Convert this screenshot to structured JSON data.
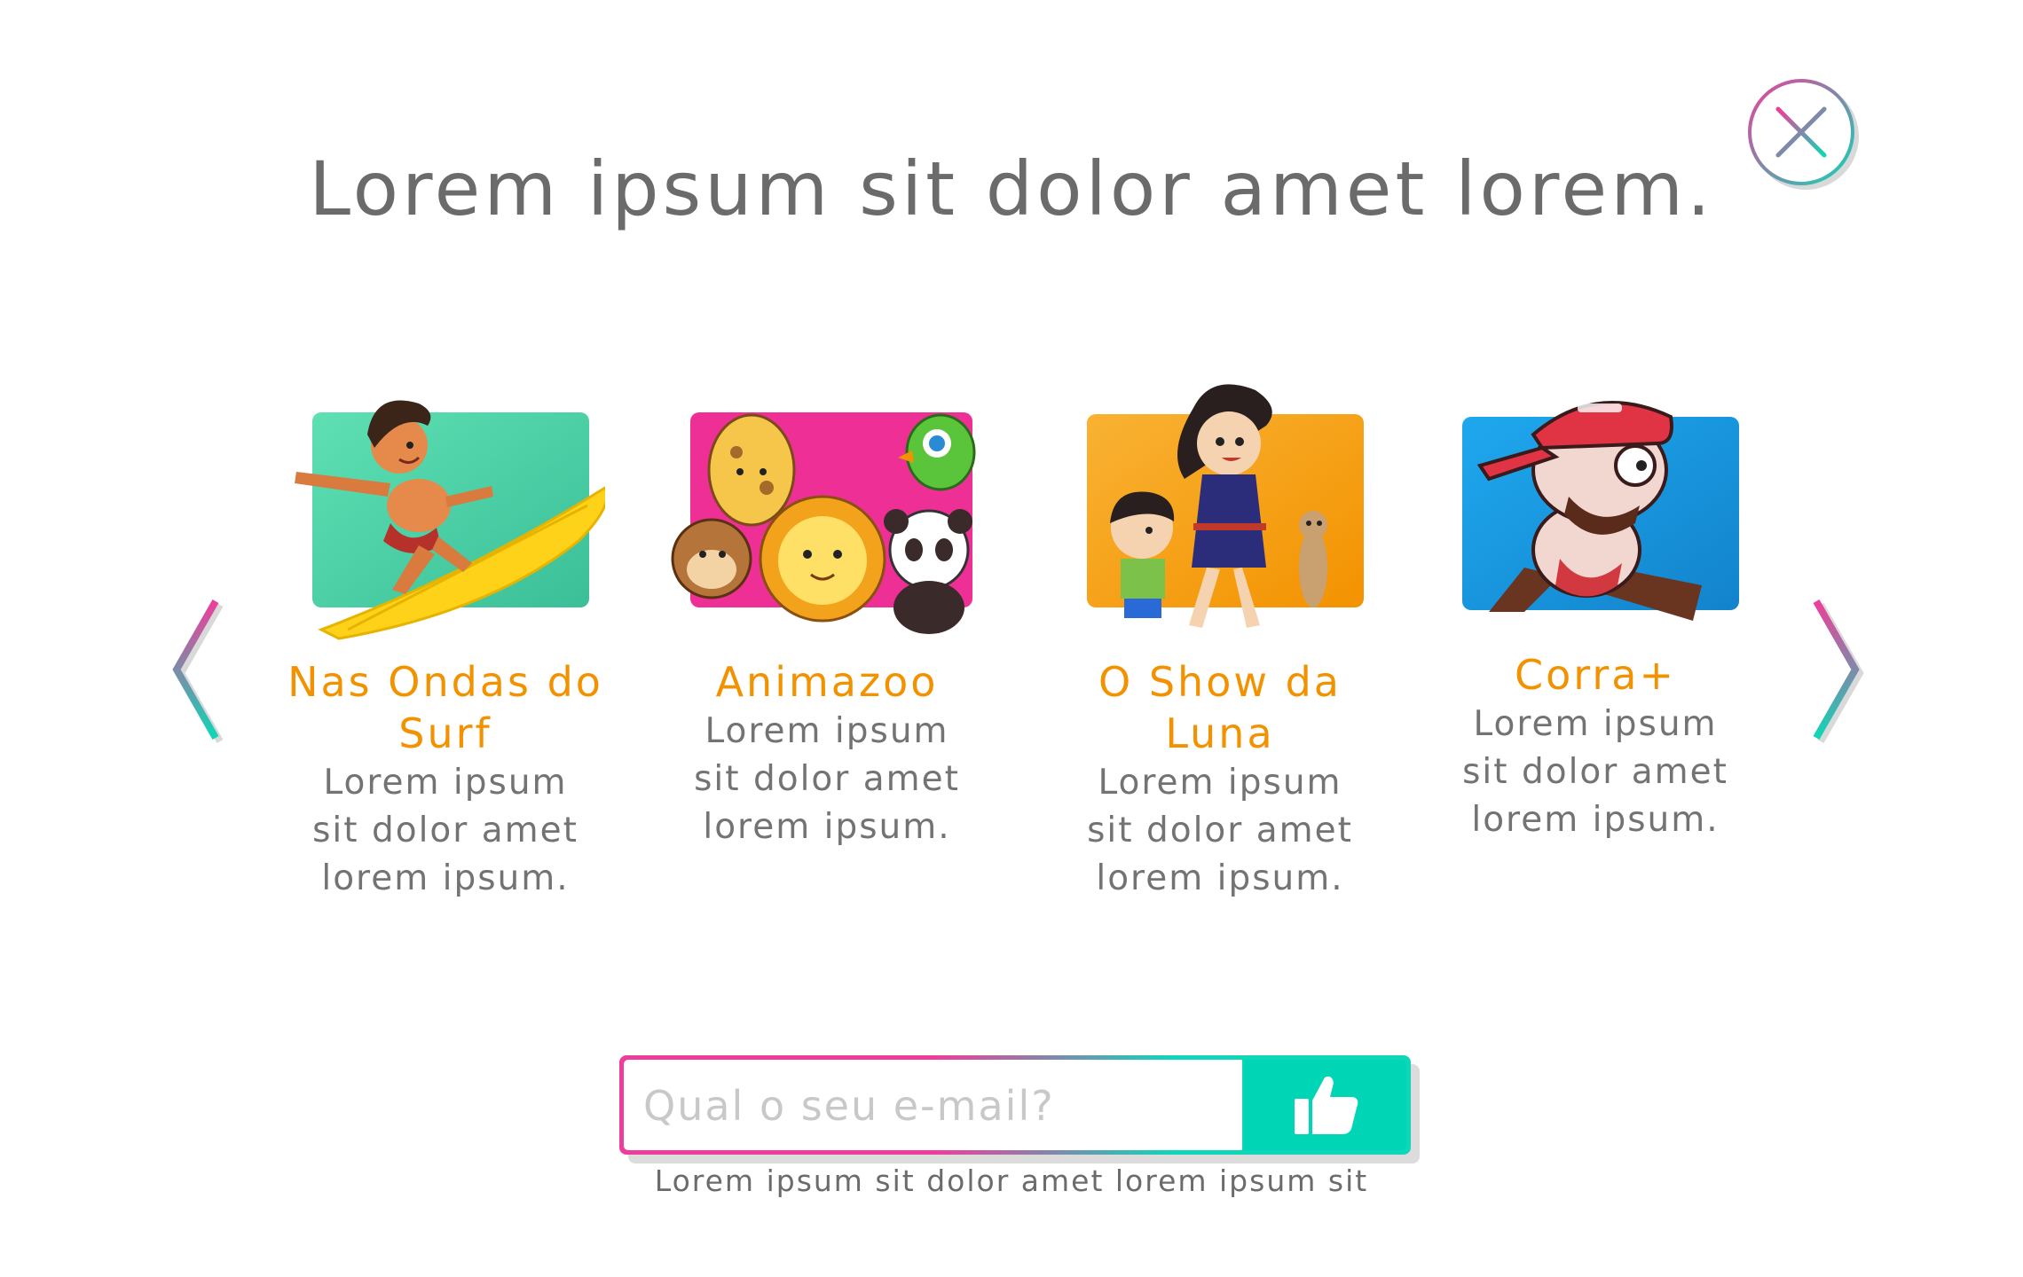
{
  "modal": {
    "title": "Lorem ipsum sit dolor amet lorem.",
    "close_icon": "close-icon",
    "prev_icon": "chevron-left-icon",
    "next_icon": "chevron-right-icon"
  },
  "shows": [
    {
      "title": "Nas Ondas do Surf",
      "description": "Lorem ipsum sit dolor amet lorem ipsum.",
      "art": "surfer-boy-illustration",
      "background_color": "#4fd6a8"
    },
    {
      "title": "Animazoo",
      "description": "Lorem ipsum sit dolor amet lorem ipsum.",
      "art": "zoo-animals-illustration",
      "background_color": "#ee2f95"
    },
    {
      "title": "O Show da Luna",
      "description": "Lorem ipsum sit dolor amet lorem ipsum.",
      "art": "luna-and-friends-illustration",
      "background_color": "#f7a21c"
    },
    {
      "title": "Corra+",
      "description": "Lorem ipsum sit dolor amet lorem ipsum.",
      "art": "running-character-illustration",
      "background_color": "#1a9be0"
    }
  ],
  "signup": {
    "email_placeholder": "Qual o seu e-mail?",
    "email_value": "",
    "submit_icon": "thumbs-up-icon",
    "note": "Lorem ipsum sit dolor amet lorem ipsum sit"
  },
  "colors": {
    "accent_pink": "#ee3e9b",
    "accent_teal": "#00d6b6",
    "title_orange": "#f39200",
    "text_gray": "#6b6b6b"
  }
}
